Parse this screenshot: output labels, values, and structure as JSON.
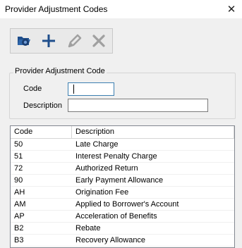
{
  "window": {
    "title": "Provider Adjustment Codes",
    "close_glyph": "✕"
  },
  "toolbar": {
    "buttons": [
      {
        "name": "open-folder-icon"
      },
      {
        "name": "add-icon"
      },
      {
        "name": "edit-icon",
        "disabled": true
      },
      {
        "name": "delete-icon",
        "disabled": true
      }
    ]
  },
  "form": {
    "group_title": "Provider Adjustment Code",
    "code_label": "Code",
    "code_value": "",
    "description_label": "Description",
    "description_value": ""
  },
  "table": {
    "columns": [
      "Code",
      "Description"
    ],
    "rows": [
      {
        "code": "50",
        "description": "Late Charge"
      },
      {
        "code": "51",
        "description": "Interest Penalty Charge"
      },
      {
        "code": "72",
        "description": "Authorized Return"
      },
      {
        "code": "90",
        "description": "Early Payment Allowance"
      },
      {
        "code": "AH",
        "description": "Origination Fee"
      },
      {
        "code": "AM",
        "description": "Applied to Borrower's Account"
      },
      {
        "code": "AP",
        "description": "Acceleration of Benefits"
      },
      {
        "code": "B2",
        "description": "Rebate"
      },
      {
        "code": "B3",
        "description": "Recovery Allowance"
      }
    ]
  },
  "colors": {
    "background": "#f0f0f0",
    "icon_blue": "#1f4e8c",
    "icon_disabled": "#a0a0a0"
  }
}
